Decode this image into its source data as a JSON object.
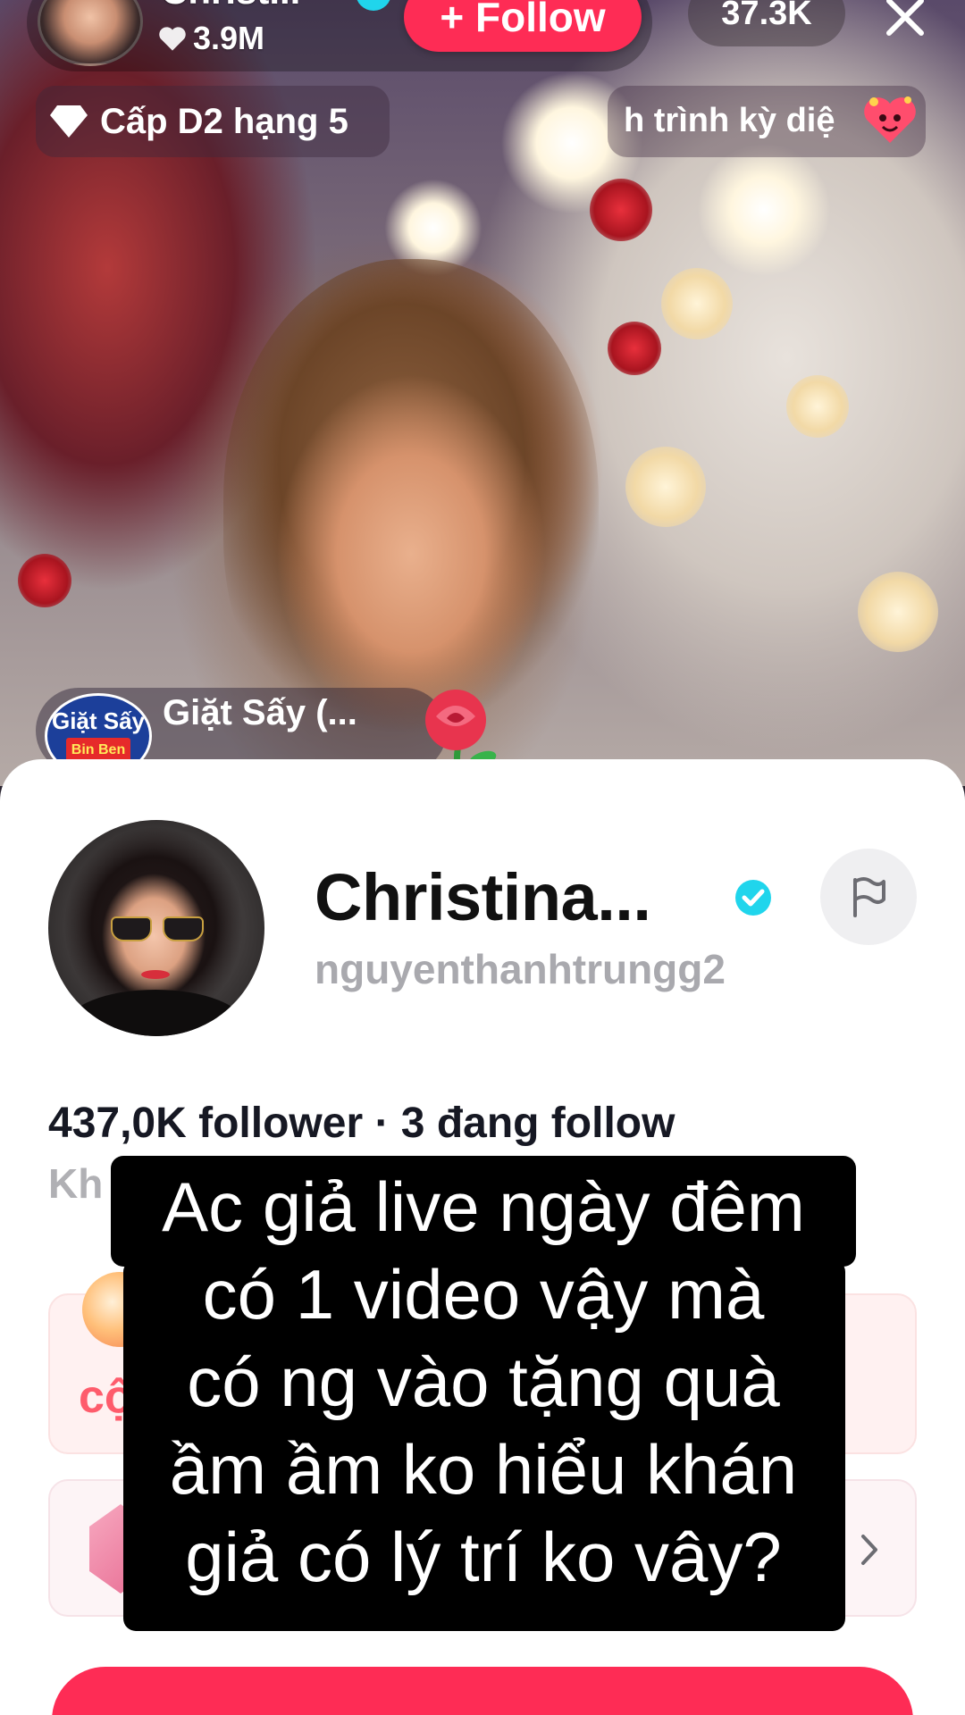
{
  "live": {
    "host_name": "Christ...",
    "likes": "3.9M",
    "follow_label": "+ Follow",
    "viewer_count": "37.3K",
    "rank_label": "Cấp D2 hạng 5",
    "journey_label": "h trình kỳ diệ"
  },
  "gift_toast": {
    "sender_name": "Giặt Sấy (...",
    "avatar_text_line1": "Giặt Sấy",
    "avatar_text_line2": "Bin Ben",
    "gift_icon": "rose-icon"
  },
  "profile": {
    "display_name": "Christina...",
    "username": "nguyenthanhtrungg2",
    "stats": "437,0K follower · 3 đang follow",
    "bio_partial": "Kh",
    "card1_label_partial": "cộ",
    "icons": {
      "verified": "verified-badge-icon",
      "report": "flag-icon",
      "chevron": "chevron-right-icon"
    }
  },
  "caption": {
    "lines": [
      "Ac giả live ngày đêm",
      "có 1 video vậy mà",
      "có ng vào tặng quà",
      "ầm ầm ko hiểu khán",
      "giả có lý trí ko vây?"
    ]
  },
  "colors": {
    "accent": "#fe2c55",
    "verified": "#20d5ec",
    "sheet_bg": "#ffffff",
    "username": "#a9a9ae"
  }
}
